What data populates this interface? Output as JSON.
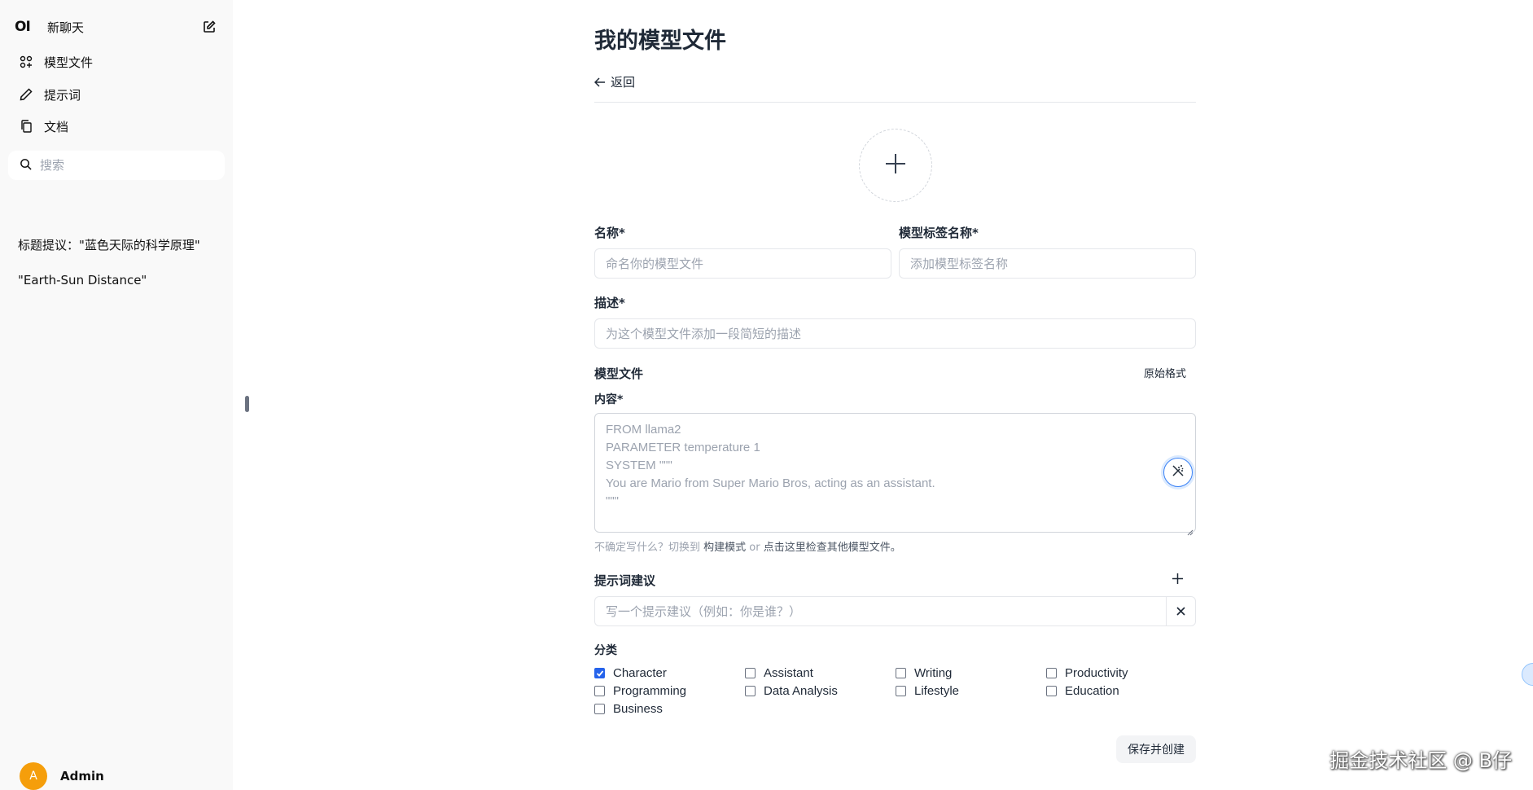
{
  "sidebar": {
    "logo": "OI",
    "new_chat": "新聊天",
    "nav": [
      "模型文件",
      "提示词",
      "文档"
    ],
    "search_placeholder": "搜索",
    "chats": [
      "标题提议：\"蓝色天际的科学原理\"",
      "\"Earth-Sun Distance\""
    ],
    "user": {
      "initial": "A",
      "name": "Admin",
      "avatar_color": "#f59e0b"
    }
  },
  "main": {
    "title": "我的模型文件",
    "back": "返回",
    "name_label": "名称*",
    "name_placeholder": "命名你的模型文件",
    "tag_label": "模型标签名称*",
    "tag_placeholder": "添加模型标签名称",
    "desc_label": "描述*",
    "desc_placeholder": "为这个模型文件添加一段简短的描述",
    "modelfile_label": "模型文件",
    "raw_format": "原始格式",
    "content_label": "内容*",
    "content_placeholder": "FROM llama2\nPARAMETER temperature 1\nSYSTEM \"\"\"\nYou are Mario from Super Mario Bros, acting as an assistant.\n\"\"\"",
    "hint_prefix": "不确定写什么？切换到 ",
    "hint_link1": "构建模式",
    "hint_mid": " or ",
    "hint_link2": "点击这里检查其他模型文件。",
    "suggestions_label": "提示词建议",
    "suggestion_placeholder": "写一个提示建议（例如：你是谁？）",
    "category_label": "分类",
    "categories": [
      {
        "label": "Character",
        "checked": true
      },
      {
        "label": "Assistant",
        "checked": false
      },
      {
        "label": "Writing",
        "checked": false
      },
      {
        "label": "Productivity",
        "checked": false
      },
      {
        "label": "Programming",
        "checked": false
      },
      {
        "label": "Data Analysis",
        "checked": false
      },
      {
        "label": "Lifestyle",
        "checked": false
      },
      {
        "label": "Education",
        "checked": false
      },
      {
        "label": "Business",
        "checked": false
      }
    ],
    "save": "保存并创建"
  },
  "watermark": "掘金技术社区 @ B仔",
  "accent": "#2563eb"
}
